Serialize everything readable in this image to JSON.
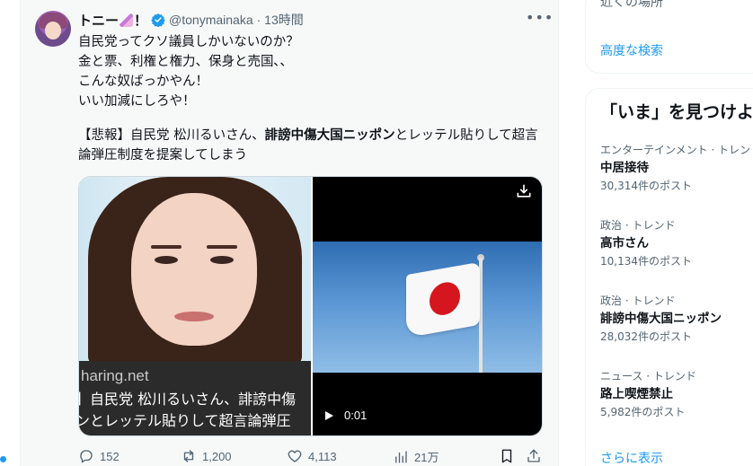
{
  "tweet": {
    "display_name": "トニー",
    "display_name_suffix": "！",
    "handle": "@tonymainaka",
    "time": "· 13時間",
    "more_label": "•••",
    "body": "自民党ってクソ議員しかいないのか？\n金と票、利権と権力、保身と売国､､\nこんな奴ばっかやん！\nいい加減にしろや！",
    "quote_prefix": "【悲報】自民党 松川るいさん、",
    "quote_bold": "誹謗中傷大国ニッポン",
    "quote_suffix": "とレッテル貼りして超言論弾圧制度を提案してしまう"
  },
  "card": {
    "domain": "haring.net",
    "title": "】自民党 松川るいさん、誹謗中傷\nンとレッテル貼りして超言論弾圧"
  },
  "video": {
    "duration": "0:01"
  },
  "actions": {
    "replies": "152",
    "retweets": "1,200",
    "likes": "4,113",
    "views": "21万"
  },
  "sidebar": {
    "near_label": "近くの場所",
    "advanced_search": "高度な検索",
    "trends_title": "「いま」を見つけよう",
    "trends": [
      {
        "category": "エンターテインメント · トレンド",
        "topic": "中居接待",
        "count": "30,314件のポスト"
      },
      {
        "category": "政治 · トレンド",
        "topic": "高市さん",
        "count": "10,134件のポスト"
      },
      {
        "category": "政治 · トレンド",
        "topic": "誹謗中傷大国ニッポン",
        "count": "28,032件のポスト"
      },
      {
        "category": "ニュース · トレンド",
        "topic": "路上喫煙禁止",
        "count": "5,982件のポスト"
      }
    ],
    "show_more": "さらに表示"
  },
  "colors": {
    "accent": "#1d9bf0",
    "text": "#0f1419",
    "secondary": "#536471"
  }
}
